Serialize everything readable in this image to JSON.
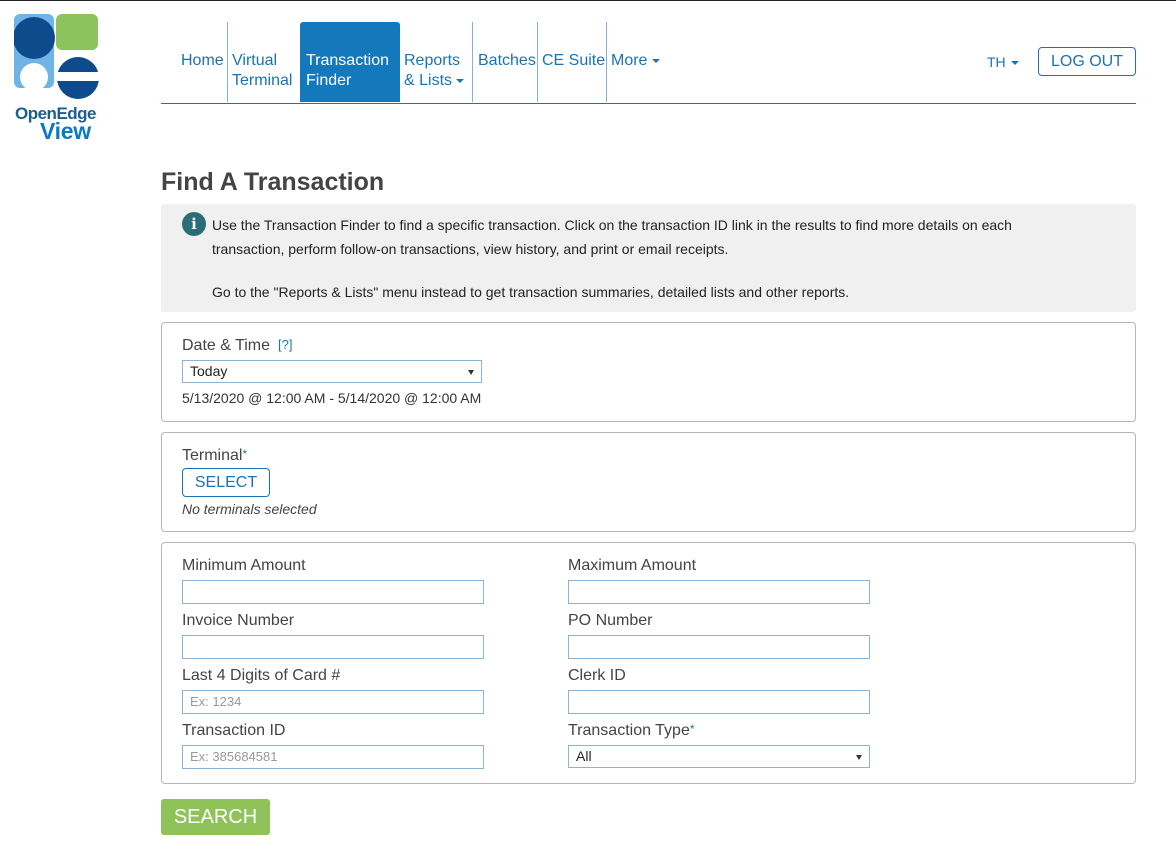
{
  "brand": {
    "name_line1": "OpenEdge",
    "name_line2": "View"
  },
  "nav": {
    "items": [
      {
        "label": "Home"
      },
      {
        "label": "Virtual Terminal"
      },
      {
        "label": "Transaction Finder"
      },
      {
        "label": "Reports & Lists"
      },
      {
        "label": "Batches"
      },
      {
        "label": "CE Suite"
      },
      {
        "label": "More"
      }
    ],
    "user_initials": "TH",
    "logout_label": "LOG OUT"
  },
  "page": {
    "title": "Find A Transaction",
    "info_text_1": "Use the Transaction Finder to find a specific transaction. Click on the transaction ID link in the results to find more details on each transaction, perform follow-on transactions, view history, and print or email receipts.",
    "info_text_2": "Go to the \"Reports & Lists\" menu instead to get transaction summaries, detailed lists and other reports."
  },
  "date_time": {
    "label": "Date & Time",
    "help": "[?]",
    "selected": "Today",
    "range_text": "5/13/2020 @ 12:00 AM - 5/14/2020 @ 12:00 AM"
  },
  "terminal": {
    "label": "Terminal",
    "required_mark": "*",
    "select_label": "SELECT",
    "status": "No terminals selected"
  },
  "filters": {
    "min_amount": {
      "label": "Minimum Amount",
      "value": ""
    },
    "max_amount": {
      "label": "Maximum Amount",
      "value": ""
    },
    "invoice_number": {
      "label": "Invoice Number",
      "value": ""
    },
    "po_number": {
      "label": "PO Number",
      "value": ""
    },
    "last4": {
      "label": "Last 4 Digits of Card #",
      "placeholder": "Ex: 1234"
    },
    "clerk_id": {
      "label": "Clerk ID",
      "value": ""
    },
    "transaction_id": {
      "label": "Transaction ID",
      "placeholder": "Ex: 385684581"
    },
    "transaction_type": {
      "label": "Transaction Type",
      "required_mark": "*",
      "selected": "All"
    }
  },
  "search_label": "SEARCH",
  "colors": {
    "accent": "#1478bd",
    "search_button": "#8fc35a",
    "info_background": "#f0f0f0"
  }
}
